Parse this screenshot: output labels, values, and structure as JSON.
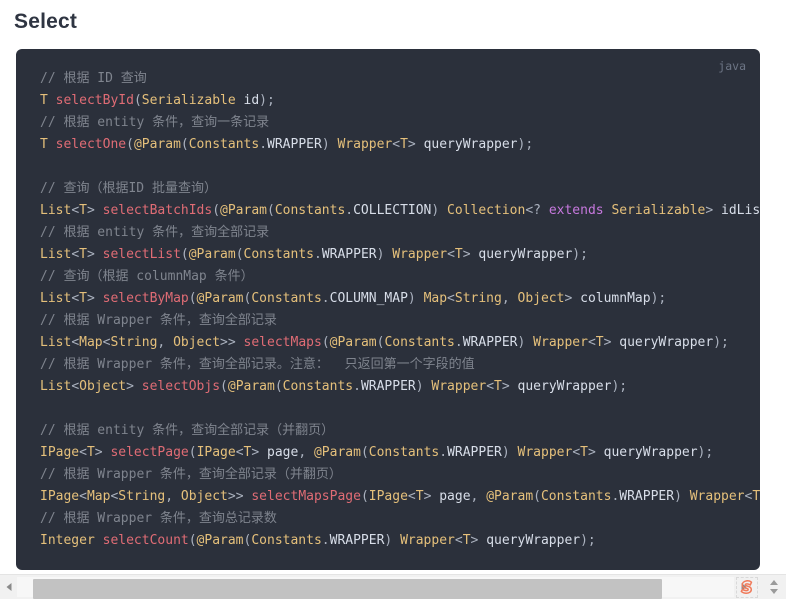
{
  "page": {
    "title": "Select"
  },
  "code_block": {
    "language_label": "java",
    "lines": [
      {
        "type": "comment",
        "text": "// 根据 ID 查询"
      },
      {
        "type": "code",
        "text": "T selectById(Serializable id);"
      },
      {
        "type": "comment",
        "text": "// 根据 entity 条件，查询一条记录"
      },
      {
        "type": "code",
        "text": "T selectOne(@Param(Constants.WRAPPER) Wrapper<T> queryWrapper);"
      },
      {
        "type": "blank",
        "text": ""
      },
      {
        "type": "comment",
        "text": "// 查询（根据ID 批量查询）"
      },
      {
        "type": "code",
        "text": "List<T> selectBatchIds(@Param(Constants.COLLECTION) Collection<? extends Serializable> idList);"
      },
      {
        "type": "comment",
        "text": "// 根据 entity 条件，查询全部记录"
      },
      {
        "type": "code",
        "text": "List<T> selectList(@Param(Constants.WRAPPER) Wrapper<T> queryWrapper);"
      },
      {
        "type": "comment",
        "text": "// 查询（根据 columnMap 条件）"
      },
      {
        "type": "code",
        "text": "List<T> selectByMap(@Param(Constants.COLUMN_MAP) Map<String, Object> columnMap);"
      },
      {
        "type": "comment",
        "text": "// 根据 Wrapper 条件，查询全部记录"
      },
      {
        "type": "code",
        "text": "List<Map<String, Object>> selectMaps(@Param(Constants.WRAPPER) Wrapper<T> queryWrapper);"
      },
      {
        "type": "comment",
        "text": "// 根据 Wrapper 条件，查询全部记录。注意：  只返回第一个字段的值"
      },
      {
        "type": "code",
        "text": "List<Object> selectObjs(@Param(Constants.WRAPPER) Wrapper<T> queryWrapper);"
      },
      {
        "type": "blank",
        "text": ""
      },
      {
        "type": "comment",
        "text": "// 根据 entity 条件，查询全部记录（并翻页）"
      },
      {
        "type": "code",
        "text": "IPage<T> selectPage(IPage<T> page, @Param(Constants.WRAPPER) Wrapper<T> queryWrapper);"
      },
      {
        "type": "comment",
        "text": "// 根据 Wrapper 条件，查询全部记录（并翻页）"
      },
      {
        "type": "code",
        "text": "IPage<Map<String, Object>> selectMapsPage(IPage<T> page, @Param(Constants.WRAPPER) Wrapper<T> queryWrapper);"
      },
      {
        "type": "comment",
        "text": "// 根据 Wrapper 条件，查询总记录数"
      },
      {
        "type": "code",
        "text": "Integer selectCount(@Param(Constants.WRAPPER) Wrapper<T> queryWrapper);"
      }
    ]
  },
  "scrollbar": {
    "left_arrow_icon": "triangle-left-icon",
    "right_arrow_icon": "triangle-right-icon",
    "watermark_icon": "sogou-s-logo-icon",
    "spinner_up_icon": "triangle-up-icon",
    "spinner_down_icon": "triangle-down-icon"
  },
  "colors": {
    "code_background": "#2b303b",
    "comment": "#7f848e",
    "type": "#e5c07b",
    "method": "#e06c75",
    "keyword": "#c678dd",
    "plain": "#abb2bf",
    "title": "#2f3542"
  }
}
